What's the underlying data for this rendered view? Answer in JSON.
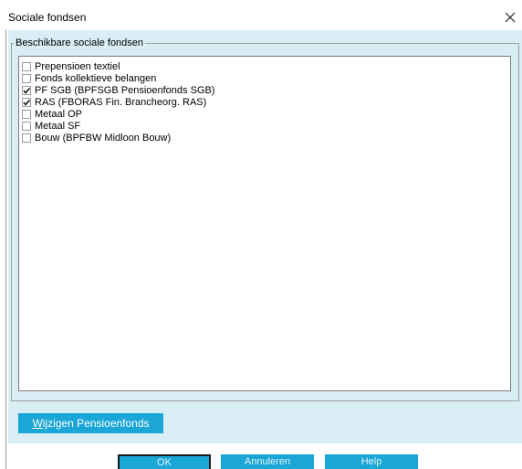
{
  "window": {
    "title": "Sociale fondsen",
    "close_icon": "close-icon"
  },
  "group": {
    "title": "Beschikbare sociale fondsen",
    "items": [
      {
        "label": "Prepensioen textiel",
        "checked": false
      },
      {
        "label": "Fonds kollektieve belangen",
        "checked": false
      },
      {
        "label": "PF SGB (BPFSGB Pensioenfonds SGB)",
        "checked": true
      },
      {
        "label": "RAS (FBORAS Fin. Brancheorg. RAS)",
        "checked": true
      },
      {
        "label": "Metaal OP",
        "checked": false
      },
      {
        "label": "Metaal SF",
        "checked": false
      },
      {
        "label": "Bouw (BPFBW Midloon Bouw)",
        "checked": false
      }
    ]
  },
  "buttons": {
    "wijzigen_mnemonic": "W",
    "wijzigen_rest": "ijzigen Pensioenfonds",
    "ok": "OK",
    "cancel": "Annuleren",
    "help": "Help"
  },
  "colors": {
    "accent": "#1aa6d6",
    "panel_background": "#d8eef4"
  }
}
